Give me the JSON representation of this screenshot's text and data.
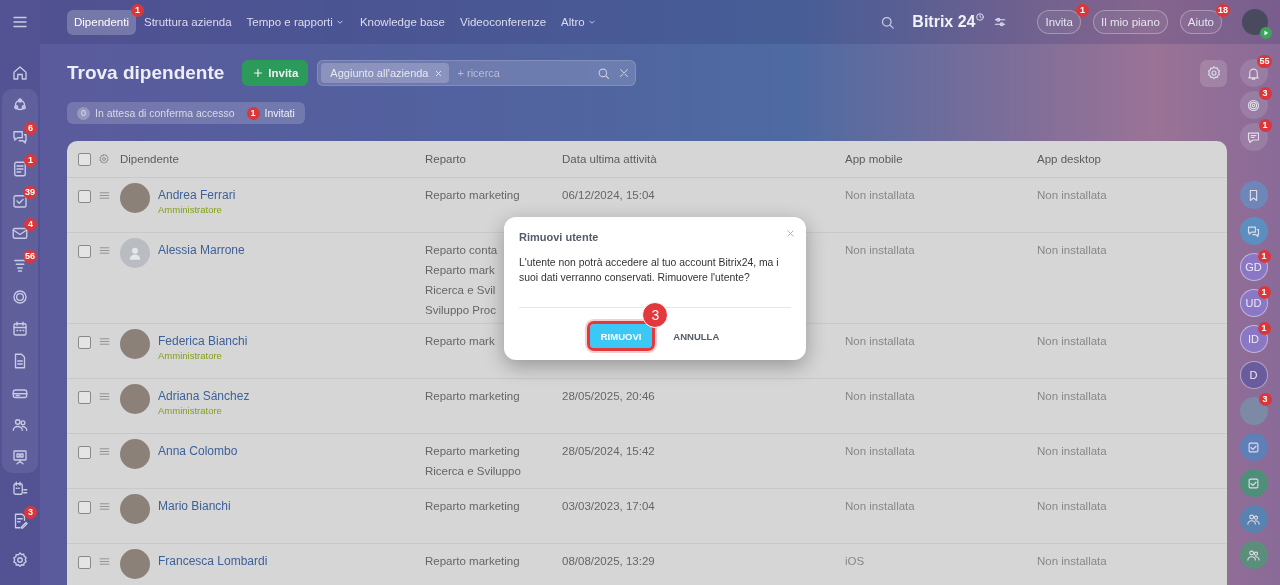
{
  "top_nav": {
    "tabs": [
      {
        "label": "Dipendenti",
        "selected": true,
        "badge": "1",
        "has_menu": false
      },
      {
        "label": "Struttura azienda",
        "selected": false,
        "has_menu": false
      },
      {
        "label": "Tempo e rapporti",
        "selected": false,
        "has_menu": true
      },
      {
        "label": "Knowledge base",
        "selected": false,
        "has_menu": false
      },
      {
        "label": "Videoconferenze",
        "selected": false,
        "has_menu": false
      },
      {
        "label": "Altro",
        "selected": false,
        "has_menu": true
      }
    ],
    "logo": "Bitrix 24",
    "buttons": [
      {
        "label": "Invita",
        "badge": "1"
      },
      {
        "label": "Il mio piano"
      },
      {
        "label": "Aiuto",
        "badge": "18"
      }
    ]
  },
  "sidebar": {
    "items": [
      {
        "kind": "home"
      },
      {
        "kind": "orbit"
      },
      {
        "kind": "chat",
        "badge": "6"
      },
      {
        "kind": "doc",
        "badge": "1"
      },
      {
        "kind": "tasks",
        "badge": "39"
      },
      {
        "kind": "mail",
        "badge": "4"
      },
      {
        "kind": "stack",
        "badge": "56"
      },
      {
        "kind": "ring"
      },
      {
        "kind": "cal"
      },
      {
        "kind": "file"
      },
      {
        "kind": "drive"
      },
      {
        "kind": "people"
      },
      {
        "kind": "board"
      },
      {
        "kind": "callist"
      },
      {
        "kind": "edit",
        "badge": "3"
      }
    ]
  },
  "page": {
    "title": "Trova dipendente",
    "invite_button": "Invita",
    "filter": {
      "chip": "Aggiunto all'azienda",
      "placeholder": "+ ricerca"
    },
    "counters": [
      {
        "count": "0",
        "label": "In attesa di conferma accesso",
        "alert": false
      },
      {
        "count": "1",
        "label": "Invitati",
        "alert": true
      }
    ]
  },
  "table": {
    "select_all_checked": false,
    "columns": [
      "Dipendente",
      "Reparto",
      "Data ultima attività",
      "App mobile",
      "App desktop"
    ],
    "rows": [
      {
        "name": "Andrea Ferrari",
        "role": "Amministratore",
        "avatar": {
          "kind": "photo"
        },
        "departments": [
          "Reparto marketing"
        ],
        "last_activity": "06/12/2024, 15:04",
        "app_mobile": "Non installata",
        "app_desktop": "Non installata",
        "checked": false
      },
      {
        "name": "Alessia Marrone",
        "avatar": {
          "kind": "generic"
        },
        "departments": [
          "Reparto conta",
          "Reparto mark",
          "Ricerca e Svil",
          "Sviluppo Proc"
        ],
        "app_mobile": "Non installata",
        "app_desktop": "Non installata",
        "checked": false
      },
      {
        "name": "Federica Bianchi",
        "role": "Amministratore",
        "avatar": {
          "kind": "photo"
        },
        "departments": [
          "Reparto mark"
        ],
        "app_mobile": "Non installata",
        "app_desktop": "Non installata",
        "checked": false
      },
      {
        "name": "Adriana Sánchez",
        "role": "Amministratore",
        "avatar": {
          "kind": "photo"
        },
        "departments": [
          "Reparto marketing"
        ],
        "last_activity": "28/05/2025, 20:46",
        "app_mobile": "Non installata",
        "app_desktop": "Non installata",
        "checked": false
      },
      {
        "name": "Anna Colombo",
        "avatar": {
          "kind": "photo"
        },
        "departments": [
          "Reparto marketing",
          "Ricerca e Sviluppo"
        ],
        "last_activity": "28/05/2024, 15:42",
        "app_mobile": "Non installata",
        "app_desktop": "Non installata",
        "checked": false
      },
      {
        "name": "Mario Bianchi",
        "avatar": {
          "kind": "photo"
        },
        "departments": [
          "Reparto marketing"
        ],
        "last_activity": "03/03/2023, 17:04",
        "app_mobile": "Non installata",
        "app_desktop": "Non installata",
        "checked": false
      },
      {
        "name": "Francesca Lombardi",
        "avatar": {
          "kind": "photo"
        },
        "departments": [
          "Reparto marketing"
        ],
        "last_activity": "08/08/2025, 13:29",
        "app_mobile": "iOS",
        "app_desktop": "Non installata",
        "checked": false
      }
    ]
  },
  "right_rail": {
    "items": [
      {
        "kind": "icon",
        "badge": "55"
      },
      {
        "kind": "icon",
        "badge": "3"
      },
      {
        "kind": "icon",
        "badge": "1"
      },
      {
        "kind": "icon",
        "color": "#6f86b8"
      },
      {
        "kind": "icon",
        "color": "#5b8fc0"
      },
      {
        "kind": "initials",
        "text": "GD",
        "badge": "1",
        "color": "#8a78c4"
      },
      {
        "kind": "initials",
        "text": "UD",
        "badge": "1",
        "color": "#8a78c4"
      },
      {
        "kind": "initials",
        "text": "ID",
        "badge": "1",
        "color": "#8a78c4"
      },
      {
        "kind": "initials",
        "text": "D",
        "color": "#6a5c9c"
      },
      {
        "kind": "avatar",
        "badge": "3"
      },
      {
        "kind": "icon",
        "color": "#5f7fb8"
      },
      {
        "kind": "icon",
        "color": "#4f8f7a"
      },
      {
        "kind": "icon",
        "color": "#5a82b0"
      },
      {
        "kind": "icon",
        "color": "#5b8f7c"
      }
    ]
  },
  "dialog": {
    "title": "Rimuovi utente",
    "message": "L'utente non potrà accedere al tuo account Bitrix24, ma i suoi dati verranno conservati. Rimuovere l'utente?",
    "buttons": [
      {
        "label": "RIMUOVI",
        "kind": "primary",
        "highlighted": true
      },
      {
        "label": "ANNULLA",
        "kind": "link",
        "highlighted": false
      }
    ],
    "step_marker": "3"
  }
}
